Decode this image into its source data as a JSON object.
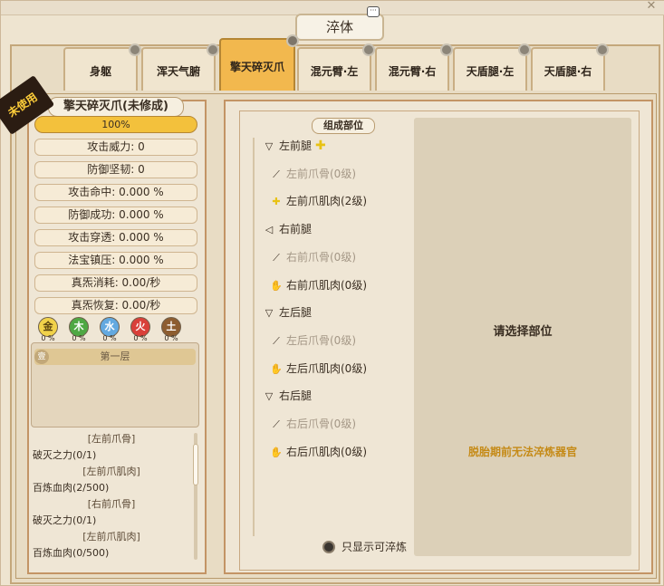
{
  "window": {
    "title": "淬体"
  },
  "tabs": [
    {
      "label": "身躯",
      "active": false
    },
    {
      "label": "浑天气腑",
      "active": false
    },
    {
      "label": "擎天碎灭爪",
      "active": true
    },
    {
      "label": "混元臂·左",
      "active": false
    },
    {
      "label": "混元臂·右",
      "active": false
    },
    {
      "label": "天盾腿·左",
      "active": false
    },
    {
      "label": "天盾腿·右",
      "active": false
    }
  ],
  "item": {
    "badge": "未使用",
    "name": "擎天碎灭爪(未修成)",
    "progress_label": "100%",
    "progress_value": 1.0,
    "stats": [
      "攻击威力: 0",
      "防御坚韧: 0",
      "攻击命中: 0.000 %",
      "防御成功: 0.000 %",
      "攻击穿透: 0.000 %",
      "法宝镇压: 0.000 %",
      "真炁消耗: 0.00/秒",
      "真炁恢复: 0.00/秒"
    ],
    "elements": [
      {
        "label": "金",
        "pct": "0 %",
        "color": "#f1d24a"
      },
      {
        "label": "木",
        "pct": "0 %",
        "color": "#4fa844"
      },
      {
        "label": "水",
        "pct": "0 %",
        "color": "#63a9e0"
      },
      {
        "label": "火",
        "pct": "0 %",
        "color": "#d9403a"
      },
      {
        "label": "土",
        "pct": "0 %",
        "color": "#8d5d30"
      }
    ],
    "layer": {
      "badge": "壹",
      "title": "第一层"
    },
    "requirements": [
      {
        "text": "[左前爪骨]",
        "header": true
      },
      {
        "text": "破灭之力(0/1)",
        "header": false
      },
      {
        "text": "[左前爪肌肉]",
        "header": true
      },
      {
        "text": "百炼血肉(2/500)",
        "header": false
      },
      {
        "text": "[右前爪骨]",
        "header": true
      },
      {
        "text": "破灭之力(0/1)",
        "header": false
      },
      {
        "text": "[左前爪肌肉]",
        "header": true
      },
      {
        "text": "百炼血肉(0/500)",
        "header": false
      }
    ]
  },
  "parts": {
    "header": "组成部位",
    "tree": [
      {
        "label": "左前腿",
        "icon": "triangle-down",
        "kind": "group",
        "extra": "plus"
      },
      {
        "label": "左前爪骨(0级)",
        "icon": "bone",
        "kind": "child",
        "dim": true
      },
      {
        "label": "左前爪肌肉(2级)",
        "icon": "plus",
        "kind": "child",
        "dim": false
      },
      {
        "label": "右前腿",
        "icon": "triangle-left",
        "kind": "group",
        "extra": ""
      },
      {
        "label": "右前爪骨(0级)",
        "icon": "bone",
        "kind": "child",
        "dim": true
      },
      {
        "label": "右前爪肌肉(0级)",
        "icon": "hand",
        "kind": "child",
        "dim": false
      },
      {
        "label": "左后腿",
        "icon": "triangle-down",
        "kind": "group",
        "extra": ""
      },
      {
        "label": "左后爪骨(0级)",
        "icon": "bone",
        "kind": "child",
        "dim": true
      },
      {
        "label": "左后爪肌肉(0级)",
        "icon": "hand",
        "kind": "child",
        "dim": false
      },
      {
        "label": "右后腿",
        "icon": "triangle-down",
        "kind": "group",
        "extra": ""
      },
      {
        "label": "右后爪骨(0级)",
        "icon": "bone",
        "kind": "child",
        "dim": true
      },
      {
        "label": "右后爪肌肉(0级)",
        "icon": "hand",
        "kind": "child",
        "dim": false
      }
    ],
    "placeholder": "请选择部位",
    "warning": "脱胎期前无法淬炼器官",
    "toggle_label": "只显示可淬炼"
  }
}
